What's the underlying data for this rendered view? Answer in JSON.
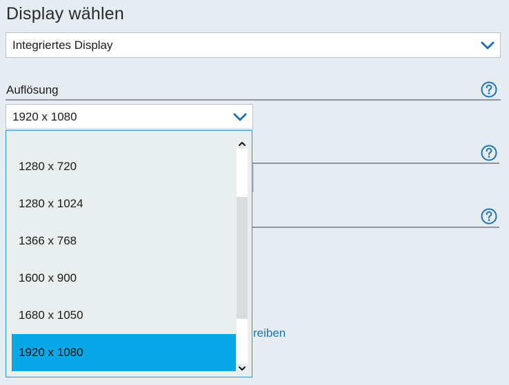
{
  "page": {
    "title": "Display wählen"
  },
  "display_select": {
    "value": "Integriertes Display"
  },
  "resolution": {
    "label": "Auflösung",
    "value": "1920 x 1080",
    "options": [
      "1280 x 720",
      "1280 x 1024",
      "1366 x 768",
      "1600 x 900",
      "1680 x 1050",
      "1920 x 1080"
    ],
    "selected_option": "1920 x 1080"
  },
  "partial_link": {
    "text": "reiben"
  },
  "colors": {
    "accent": "#06a8e8",
    "chevron": "#1b73b5",
    "link": "#1b73b5",
    "background": "#e6edf2"
  },
  "icons": [
    "chevron-down-icon",
    "help-icon",
    "scroll-up-icon",
    "scroll-down-icon"
  ]
}
